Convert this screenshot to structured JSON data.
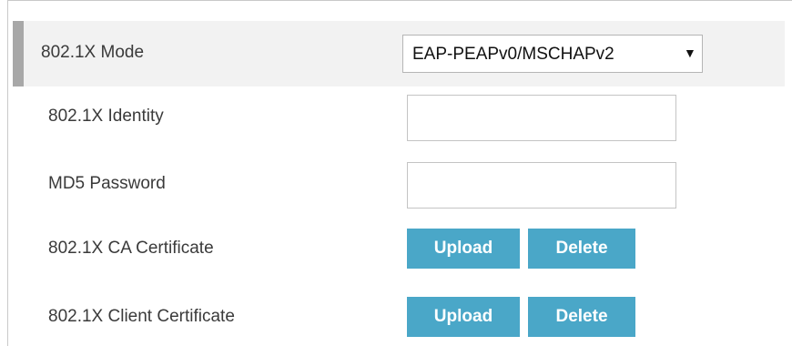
{
  "mode": {
    "label": "802.1X Mode",
    "selected": "EAP-PEAPv0/MSCHAPv2",
    "arrow": "▼"
  },
  "identity": {
    "label": "802.1X Identity",
    "value": ""
  },
  "password": {
    "label": "MD5 Password",
    "value": ""
  },
  "ca_certificate": {
    "label": "802.1X CA Certificate",
    "upload_label": "Upload",
    "delete_label": "Delete"
  },
  "client_certificate": {
    "label": "802.1X Client Certificate",
    "upload_label": "Upload",
    "delete_label": "Delete"
  },
  "colors": {
    "button": "#4aa7c8",
    "selected_row": "#f2f2f2",
    "selected_row_marker": "#a8a8a8"
  }
}
